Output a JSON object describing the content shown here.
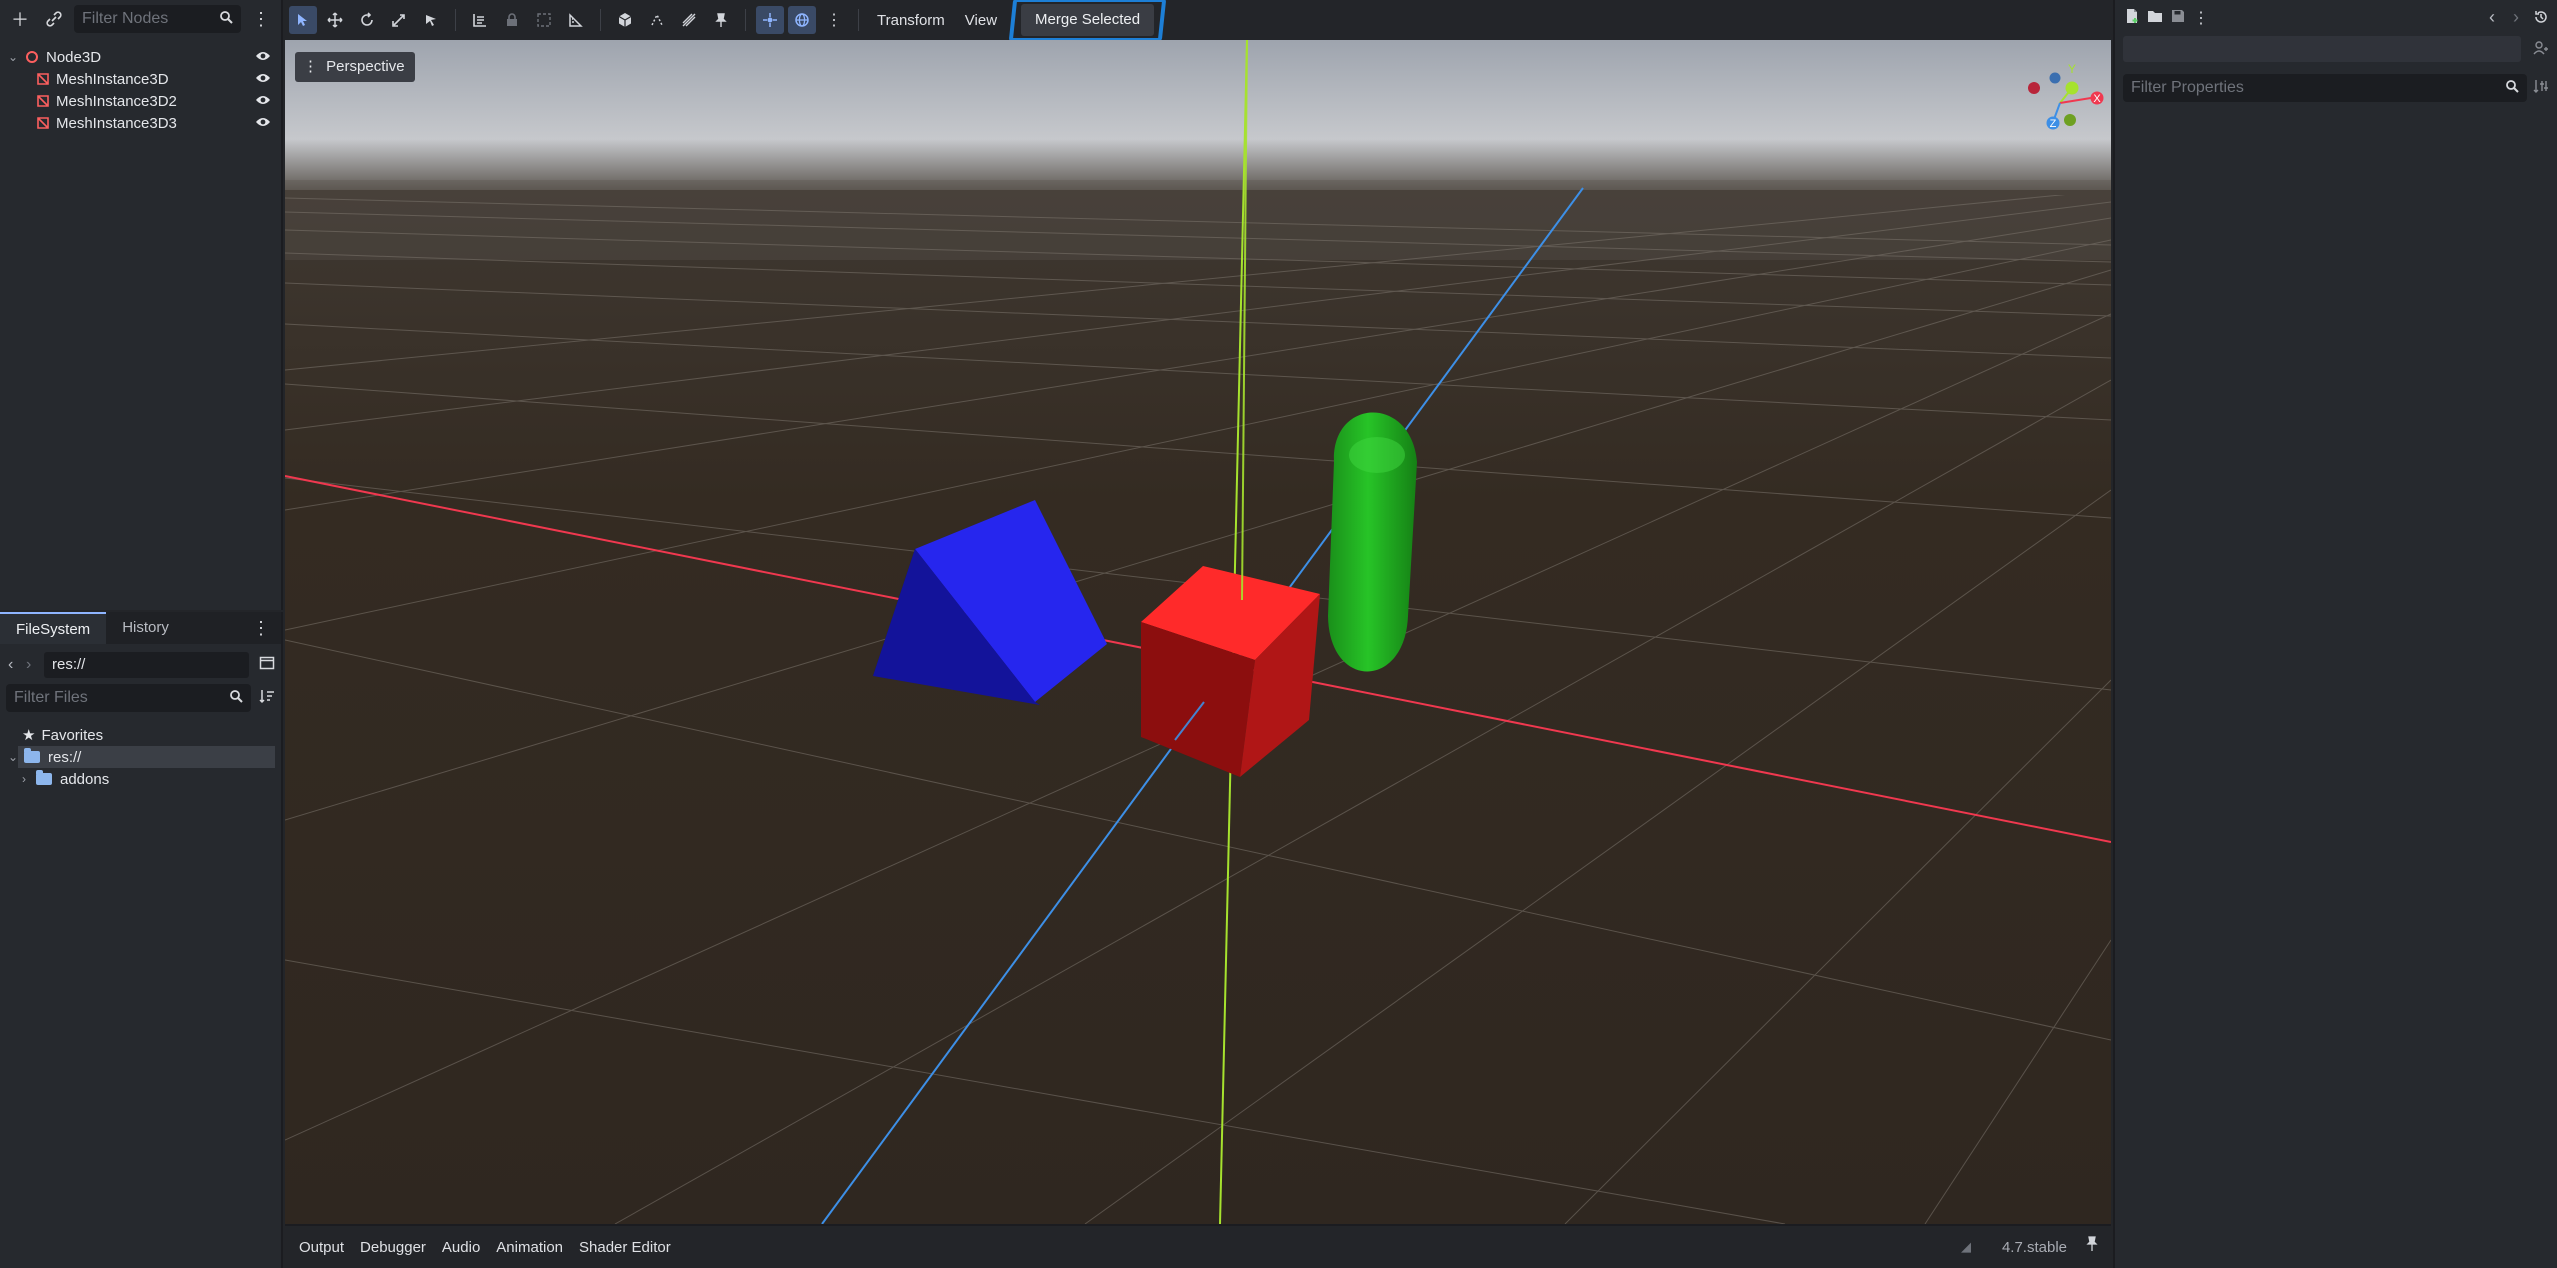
{
  "scene_dock": {
    "filter_placeholder": "Filter Nodes",
    "nodes": [
      {
        "label": "Node3D"
      },
      {
        "label": "MeshInstance3D"
      },
      {
        "label": "MeshInstance3D2"
      },
      {
        "label": "MeshInstance3D3"
      }
    ]
  },
  "filesystem": {
    "tabs": [
      "FileSystem",
      "History"
    ],
    "path": "res://",
    "filter_placeholder": "Filter Files",
    "items": [
      {
        "label": "Favorites"
      },
      {
        "label": "res://"
      },
      {
        "label": "addons"
      }
    ]
  },
  "toolbar": {
    "transform_label": "Transform",
    "view_label": "View",
    "merge_label": "Merge Selected"
  },
  "viewport": {
    "perspective_label": "Perspective",
    "gizmo_axes": [
      "Y",
      "Z",
      "X"
    ]
  },
  "bottom_panel": {
    "tabs": [
      "Output",
      "Debugger",
      "Audio",
      "Animation",
      "Shader Editor"
    ],
    "version": "4.7.stable"
  },
  "inspector": {
    "filter_placeholder": "Filter Properties"
  },
  "colors": {
    "accent": "#8fb5ff",
    "highlight_box": "#1d7fd6",
    "x_axis": "#f0384f",
    "y_axis": "#a6e22e",
    "z_axis": "#3d8fe6",
    "cube": "#e02020",
    "prism": "#1c1cd6",
    "capsule": "#22b022"
  }
}
